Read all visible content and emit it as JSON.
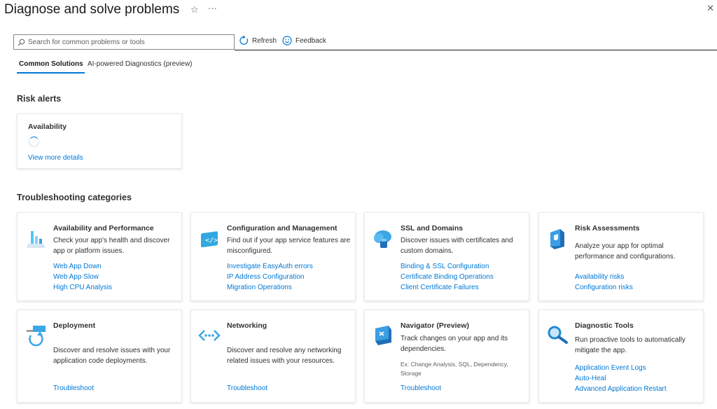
{
  "header": {
    "title": "Diagnose and solve problems",
    "star_glyph": "☆",
    "more_glyph": "···",
    "close_glyph": "✕"
  },
  "toolbar": {
    "search_placeholder": "Search for common problems or tools",
    "refresh_label": "Refresh",
    "feedback_label": "Feedback"
  },
  "tabs": [
    {
      "label": "Common Solutions",
      "active": true
    },
    {
      "label": "AI-powered Diagnostics (preview)",
      "active": false
    }
  ],
  "risk_alerts": {
    "heading": "Risk alerts",
    "card": {
      "title": "Availability",
      "link": "View more details"
    }
  },
  "troubleshooting": {
    "heading": "Troubleshooting categories",
    "categories": [
      {
        "title": "Availability and Performance",
        "icon": "chart-icon",
        "description": "Check your app's health and discover app or platform issues.",
        "links": [
          "Web App Down",
          "Web App Slow",
          "High CPU Analysis"
        ]
      },
      {
        "title": "Configuration and Management",
        "icon": "config-icon",
        "description": "Find out if your app service features are misconfigured.",
        "links": [
          "Investigate EasyAuth errors",
          "IP Address Configuration",
          "Migration Operations"
        ]
      },
      {
        "title": "SSL and Domains",
        "icon": "cloud-globe-icon",
        "description": "Discover issues with certificates and custom domains.",
        "links": [
          "Binding & SSL Configuration",
          "Certificate Binding Operations",
          "Client Certificate Failures"
        ]
      },
      {
        "title": "Risk Assessments",
        "icon": "shield-book-icon",
        "description": "Analyze your app for optimal performance and configurations.",
        "links": [
          "Availability risks",
          "Configuration risks"
        ]
      },
      {
        "title": "Deployment",
        "icon": "deployment-icon",
        "description": "Discover and resolve issues with your application code deployments.",
        "links": [
          "Troubleshoot"
        ]
      },
      {
        "title": "Networking",
        "icon": "network-icon",
        "description": "Discover and resolve any networking related issues with your resources.",
        "links": [
          "Troubleshoot"
        ]
      },
      {
        "title": "Navigator (Preview)",
        "icon": "navigator-icon",
        "description": "Track changes on your app and its dependencies.",
        "extra": "Ex: Change Analysis, SQL, Dependency, Storage",
        "links": [
          "Troubleshoot"
        ]
      },
      {
        "title": "Diagnostic Tools",
        "icon": "magnifier-icon",
        "description": "Run proactive tools to automatically mitigate the app.",
        "links": [
          "Application Event Logs",
          "Auto-Heal",
          "Advanced Application Restart"
        ]
      }
    ]
  },
  "colors": {
    "link": "#0078d4",
    "accent": "#0078d4",
    "text": "#323130"
  }
}
